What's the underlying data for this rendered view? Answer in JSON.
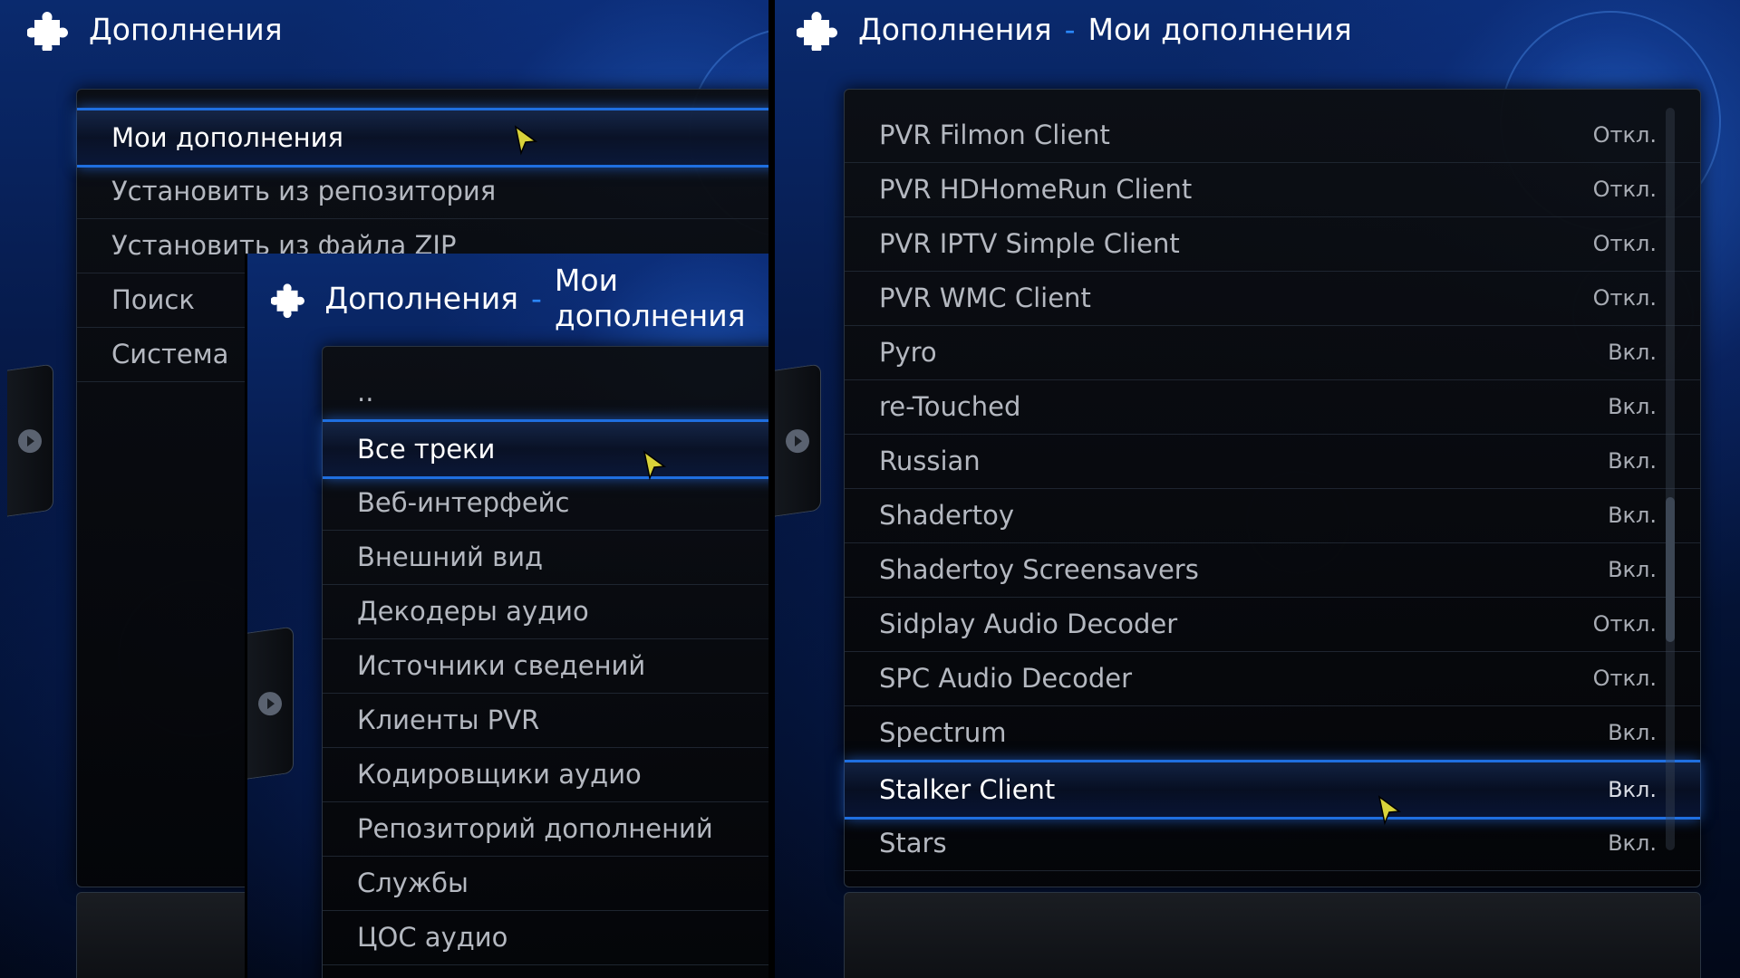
{
  "left": {
    "header": {
      "title": "Дополнения"
    },
    "menu": [
      {
        "label": "Мои дополнения",
        "selected": true
      },
      {
        "label": "Установить из репозитория"
      },
      {
        "label": "Установить из файла ZIP"
      },
      {
        "label": "Поиск"
      },
      {
        "label": "Система"
      }
    ]
  },
  "middle": {
    "header": {
      "title": "Дополнения",
      "subtitle": "Мои дополнения"
    },
    "menu": [
      {
        "label": ".."
      },
      {
        "label": "Все треки",
        "selected": true
      },
      {
        "label": "Веб-интерфейс"
      },
      {
        "label": "Внешний вид"
      },
      {
        "label": "Декодеры аудио"
      },
      {
        "label": "Источники сведений"
      },
      {
        "label": "Клиенты PVR"
      },
      {
        "label": "Кодировщики аудио"
      },
      {
        "label": "Репозиторий дополнений"
      },
      {
        "label": "Службы"
      },
      {
        "label": "ЦОС аудио"
      }
    ]
  },
  "right": {
    "header": {
      "title": "Дополнения",
      "subtitle": "Мои дополнения"
    },
    "addons": [
      {
        "name": "PVR Filmon Client",
        "status": "Откл."
      },
      {
        "name": "PVR HDHomeRun Client",
        "status": "Откл."
      },
      {
        "name": "PVR IPTV Simple Client",
        "status": "Откл."
      },
      {
        "name": "PVR WMC Client",
        "status": "Откл."
      },
      {
        "name": "Pyro",
        "status": "Вкл."
      },
      {
        "name": "re-Touched",
        "status": "Вкл."
      },
      {
        "name": "Russian",
        "status": "Вкл."
      },
      {
        "name": "Shadertoy",
        "status": "Вкл."
      },
      {
        "name": "Shadertoy Screensavers",
        "status": "Вкл."
      },
      {
        "name": "Sidplay Audio Decoder",
        "status": "Откл."
      },
      {
        "name": "SPC Audio Decoder",
        "status": "Откл."
      },
      {
        "name": "Spectrum",
        "status": "Вкл."
      },
      {
        "name": "Stalker Client",
        "status": "Вкл.",
        "selected": true
      },
      {
        "name": "Stars",
        "status": "Вкл."
      }
    ]
  },
  "icons": {
    "header": "puzzle-icon",
    "tab_arrow": "play-arrow-icon",
    "pointer": "mouse-cursor-icon"
  },
  "colors": {
    "accent": "#2b88ff",
    "selection": "#1f6fe0",
    "background": "#061a4a"
  }
}
